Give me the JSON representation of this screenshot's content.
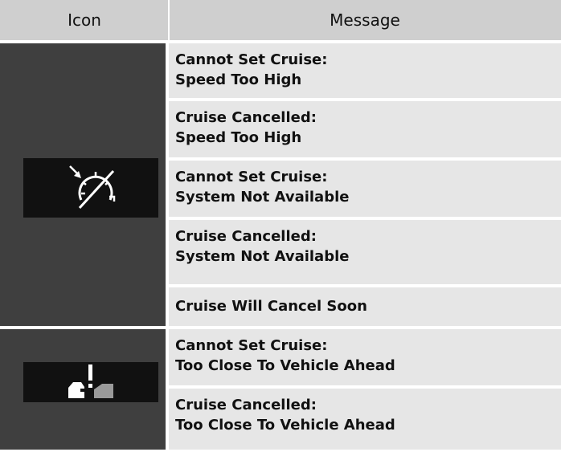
{
  "header": {
    "icon_col": "Icon",
    "message_col": "Message"
  },
  "groups": [
    {
      "icon": "cruise-control-cancelled-icon",
      "rows": [
        {
          "line1": "Cannot Set Cruise:",
          "line2": "Speed Too High"
        },
        {
          "line1": "Cruise Cancelled:",
          "line2": "Speed Too High"
        },
        {
          "line1": "Cannot Set Cruise:",
          "line2": "System Not Available"
        },
        {
          "line1": "Cruise Cancelled:",
          "line2": "System Not Available"
        },
        {
          "line1": "Cruise Will Cancel Soon",
          "line2": ""
        }
      ]
    },
    {
      "icon": "vehicle-too-close-warning-icon",
      "rows": [
        {
          "line1": "Cannot Set Cruise:",
          "line2": "Too Close To Vehicle Ahead"
        },
        {
          "line1": "Cruise Cancelled:",
          "line2": "Too Close To Vehicle Ahead"
        }
      ]
    }
  ],
  "colors": {
    "header_bg": "#cfcfcf",
    "icon_cell_bg": "#3f3f3f",
    "icon_box_bg": "#111111",
    "row_bg": "#e6e6e6"
  }
}
